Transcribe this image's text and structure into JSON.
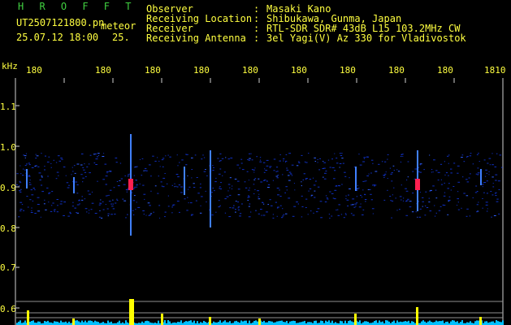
{
  "header": {
    "title": "H R O F F T",
    "filename": "UT2507121800.pn",
    "datetime": "25.07.12 18:00",
    "meteor_label": "meteor",
    "count_fragment": "25."
  },
  "info": [
    {
      "label": "Observer",
      "value": "Masaki Kano"
    },
    {
      "label": "Receiving Location",
      "value": "Shibukawa, Gunma, Japan"
    },
    {
      "label": "Receiver",
      "value": "RTL-SDR SDR# 43dB L15 103.2MHz CW"
    },
    {
      "label": "Receiving Antenna",
      "value": "3el Yagi(V) Az 330 for Vladivostok"
    }
  ],
  "y_axis": {
    "unit": "kHz",
    "ticks": [
      "1.1",
      "1.0",
      "0.9",
      "0.8",
      "0.7",
      "0.6"
    ]
  },
  "x_axis": {
    "ticks": [
      "180",
      "180",
      "180",
      "180",
      "180",
      "180",
      "180",
      "180",
      "180",
      "1810"
    ]
  },
  "colors": {
    "background": "#000000",
    "text": "#ffff40",
    "title": "#40d040",
    "noise": "#1030c0",
    "strong": "#ff2050",
    "band": "#ffff00",
    "baseline": "#00c0ff"
  },
  "spectrogram": {
    "band_center_khz": 0.91,
    "meteor_events_minute": [
      1802.5,
      1808.8
    ]
  }
}
